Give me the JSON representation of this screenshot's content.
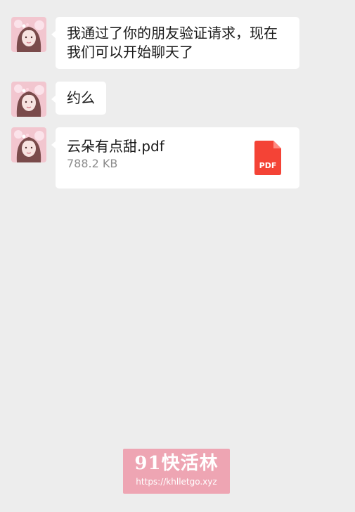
{
  "messages": [
    {
      "text": "我通过了你的朋友验证请求，现在我们可以开始聊天了"
    },
    {
      "text": "约么"
    },
    {
      "file_name": "云朵有点甜.pdf",
      "file_size": "788.2 KB",
      "file_type": "PDF"
    }
  ],
  "avatar": {
    "icon": "avatar-photo",
    "colors": {
      "bg": "#f2c6cf",
      "hair": "#7a4b4b",
      "face": "#f7e3e0"
    }
  },
  "watermark": {
    "title": "91快活林",
    "url": "https://khlletgo.xyz"
  },
  "colors": {
    "background": "#ededed",
    "bubble": "#ffffff",
    "pdf": "#f44336",
    "watermark": "#eea5b3"
  }
}
